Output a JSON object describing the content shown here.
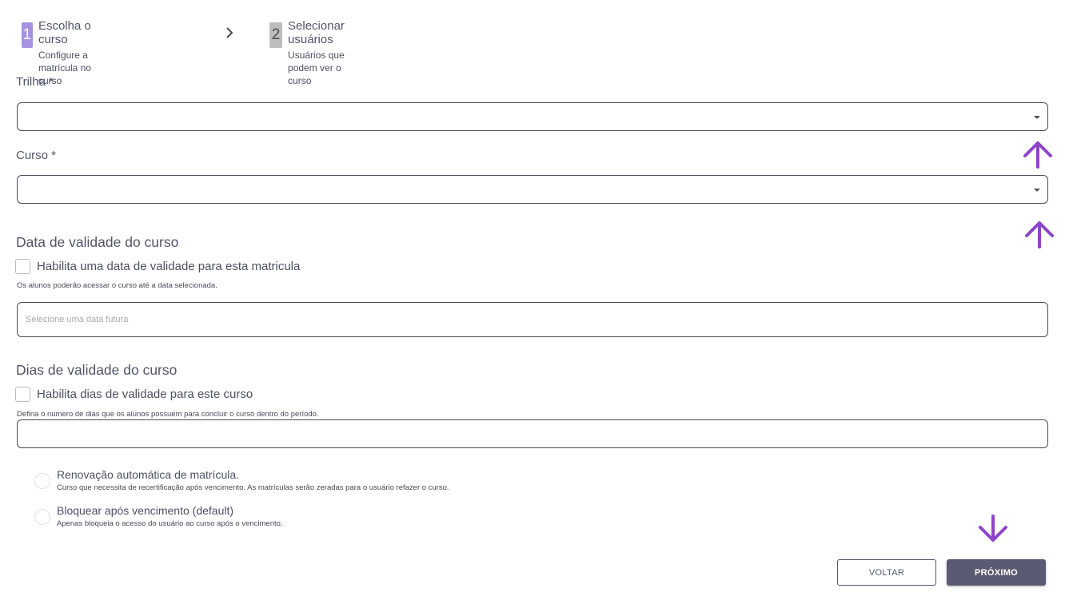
{
  "stepper": {
    "steps": [
      {
        "number": "1",
        "title": "Escolha o curso",
        "subtitle": "Configure a matrícula no curso"
      },
      {
        "number": "2",
        "title": "Selecionar usuários",
        "subtitle": "Usuários que podem ver o curso"
      }
    ]
  },
  "form": {
    "trilha_label": "Trilha *",
    "curso_label": "Curso *",
    "validity_date": {
      "heading": "Data de validade do curso",
      "checkbox_label": "Habilita uma data de validade para esta matricula",
      "checked": false,
      "help": "Os alunos poderão acessar o curso até a data selecionada.",
      "placeholder": "Selecione uma data futura"
    },
    "validity_days": {
      "heading": "Dias de validade do curso",
      "checkbox_label": "Habilita dias de validade para este curso",
      "checked": false,
      "help": "Defina o numero de dias que os alunos possuem para concluir o curso dentro do período."
    },
    "radios": [
      {
        "title": "Renovação automática de matrícula.",
        "subtitle": "Curso que necessita de recertificação após vencimento. As matrículas serão zeradas para o usuário refazer o curso."
      },
      {
        "title": "Bloquear após vencimento (default)",
        "subtitle": "Apenas bloqueia o acesso do usuário ao curso após o vencimento."
      }
    ]
  },
  "actions": {
    "back_label": "VOLTAR",
    "next_label": "PRÓXIMO"
  },
  "colors": {
    "accent": "#a593e0",
    "annotation_arrow": "#8e44c9",
    "primary_button": "#5a5a72"
  },
  "icons": [
    "chevron-right-icon",
    "caret-down-icon",
    "arrow-up-icon",
    "arrow-down-icon"
  ]
}
